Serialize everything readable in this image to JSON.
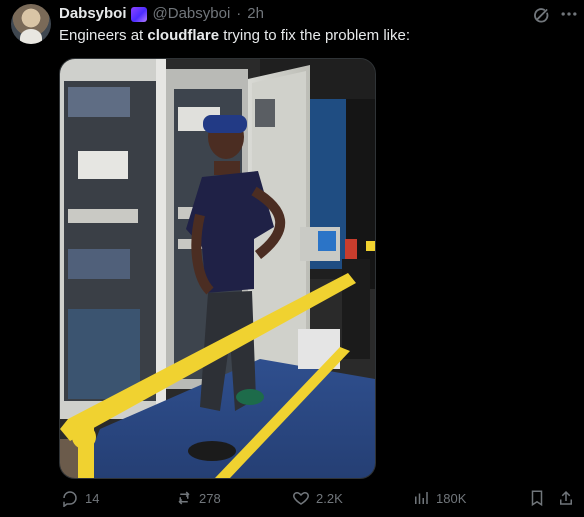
{
  "author": {
    "display_name": "Dabsyboi",
    "handle": "@Dabsyboi",
    "time": "2h"
  },
  "tweet": {
    "text_before": "Engineers at ",
    "text_bold": "cloudflare",
    "text_after": " trying to fix the problem like:"
  },
  "actions": {
    "replies": "14",
    "reposts": "278",
    "likes": "2.2K",
    "views": "180K"
  },
  "icons": {
    "reply": "reply-icon",
    "repost": "repost-icon",
    "like": "heart-icon",
    "views": "views-icon",
    "bookmark": "bookmark-icon",
    "share": "share-icon",
    "grok": "grok-icon",
    "more": "more-icon"
  },
  "colors": {
    "background": "#000000",
    "text_primary": "#e7e9ea",
    "text_secondary": "#71767b",
    "border": "#2f3336"
  }
}
